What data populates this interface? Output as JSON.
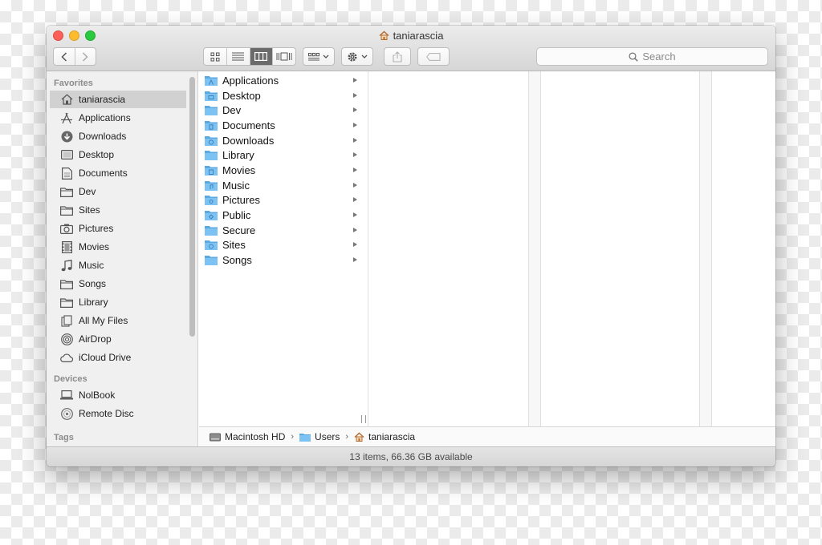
{
  "window": {
    "title": "taniarascia",
    "status": "13 items, 66.36 GB available"
  },
  "toolbar": {
    "search_placeholder": "Search"
  },
  "sidebar": {
    "favorites_header": "Favorites",
    "favorites": [
      {
        "label": "taniarascia",
        "icon": "home-icon"
      },
      {
        "label": "Applications",
        "icon": "applications-icon"
      },
      {
        "label": "Downloads",
        "icon": "downloads-icon"
      },
      {
        "label": "Desktop",
        "icon": "desktop-icon"
      },
      {
        "label": "Documents",
        "icon": "documents-icon"
      },
      {
        "label": "Dev",
        "icon": "folder-icon"
      },
      {
        "label": "Sites",
        "icon": "folder-icon"
      },
      {
        "label": "Pictures",
        "icon": "camera-icon"
      },
      {
        "label": "Movies",
        "icon": "film-icon"
      },
      {
        "label": "Music",
        "icon": "music-note-icon"
      },
      {
        "label": "Songs",
        "icon": "folder-icon"
      },
      {
        "label": "Library",
        "icon": "folder-icon"
      },
      {
        "label": "All My Files",
        "icon": "all-files-icon"
      },
      {
        "label": "AirDrop",
        "icon": "airdrop-icon"
      },
      {
        "label": "iCloud Drive",
        "icon": "cloud-icon"
      }
    ],
    "devices_header": "Devices",
    "devices": [
      {
        "label": "NolBook",
        "icon": "laptop-icon"
      },
      {
        "label": "Remote Disc",
        "icon": "disc-icon"
      }
    ],
    "tags_header": "Tags"
  },
  "column": {
    "items": [
      "Applications",
      "Desktop",
      "Dev",
      "Documents",
      "Downloads",
      "Library",
      "Movies",
      "Music",
      "Pictures",
      "Public",
      "Secure",
      "Sites",
      "Songs"
    ]
  },
  "pathbar": {
    "items": [
      "Macintosh HD",
      "Users",
      "taniarascia"
    ]
  },
  "colors": {
    "folder": "#6fb8ec",
    "selected": "#d1d1d1",
    "close": "#fc5f57",
    "minimize": "#fdbc2e",
    "maximize": "#2ac940"
  }
}
